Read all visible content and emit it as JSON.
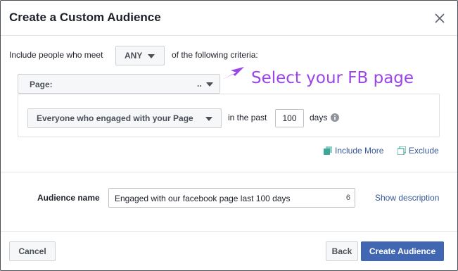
{
  "dialog": {
    "title": "Create a Custom Audience",
    "close_icon": "close-icon"
  },
  "criteria": {
    "prefix": "Include people who meet",
    "match_value": "ANY",
    "suffix": "of the following criteria:"
  },
  "source": {
    "label": "Page:",
    "value": ".."
  },
  "rule": {
    "engagement_type": "Everyone who engaged with your Page",
    "in_the_past_label": "in the past",
    "days_value": "100",
    "days_label": "days",
    "info_icon": "info-icon"
  },
  "annotation": {
    "text": "Select your FB page",
    "color": "#9b44e8"
  },
  "actions": {
    "include_more": "Include More",
    "exclude": "Exclude"
  },
  "audience": {
    "name_label": "Audience name",
    "name_value": "Engaged with our facebook page last 100 days",
    "char_count": "6",
    "show_description": "Show description"
  },
  "footer": {
    "cancel": "Cancel",
    "back": "Back",
    "create": "Create Audience"
  },
  "colors": {
    "primary": "#4267b2",
    "link": "#365899",
    "icon_teal": "#3fa79a"
  }
}
